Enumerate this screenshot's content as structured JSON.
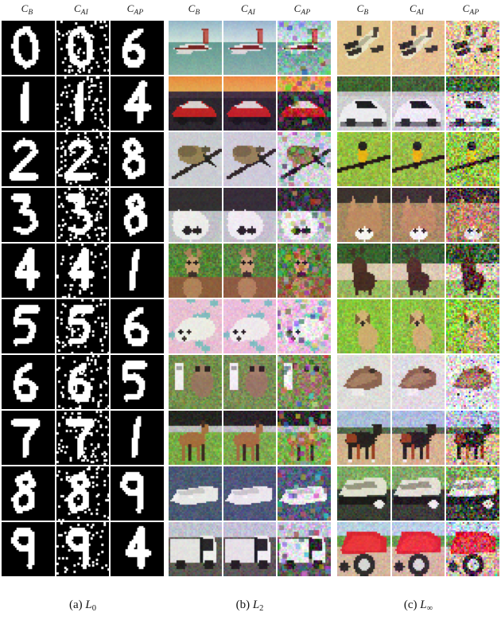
{
  "figure": {
    "type": "image-grid-figure",
    "rows": 10,
    "columns_per_panel": 3,
    "panels_count": 3,
    "column_header_labels": [
      "C_B",
      "C_AI",
      "C_AP"
    ],
    "header_base": "C",
    "header_subs": [
      "B",
      "AI",
      "AP"
    ]
  },
  "headers": [
    {
      "base": "C",
      "sub": "B"
    },
    {
      "base": "C",
      "sub": "AI"
    },
    {
      "base": "C",
      "sub": "AP"
    },
    {
      "base": "C",
      "sub": "B"
    },
    {
      "base": "C",
      "sub": "AI"
    },
    {
      "base": "C",
      "sub": "AP"
    },
    {
      "base": "C",
      "sub": "B"
    },
    {
      "base": "C",
      "sub": "AI"
    },
    {
      "base": "C",
      "sub": "AP"
    }
  ],
  "captions": [
    {
      "tag": "(a)",
      "var": "L",
      "sub": "0",
      "full": "(a) L0"
    },
    {
      "tag": "(b)",
      "var": "L",
      "sub": "2",
      "full": "(b) L2"
    },
    {
      "tag": "(c)",
      "var": "L",
      "sub": "∞",
      "full": "(c) L∞"
    }
  ],
  "panels": [
    {
      "id": "panel-a",
      "caption": "(a) L0",
      "dataset": "MNIST",
      "background": "#000000",
      "rows": [
        {
          "label": "0",
          "digit": 0,
          "adversarial_label": "6"
        },
        {
          "label": "1",
          "digit": 1,
          "adversarial_label": "4"
        },
        {
          "label": "2",
          "digit": 2,
          "adversarial_label": "8"
        },
        {
          "label": "3",
          "digit": 3,
          "adversarial_label": "8"
        },
        {
          "label": "4",
          "digit": 4,
          "adversarial_label": "1"
        },
        {
          "label": "5",
          "digit": 5,
          "adversarial_label": "6"
        },
        {
          "label": "6",
          "digit": 6,
          "adversarial_label": "5"
        },
        {
          "label": "7",
          "digit": 7,
          "adversarial_label": "1"
        },
        {
          "label": "8",
          "digit": 8,
          "adversarial_label": "9"
        },
        {
          "label": "9",
          "digit": 9,
          "adversarial_label": "4"
        }
      ]
    },
    {
      "id": "panel-b",
      "caption": "(b) L2",
      "dataset": "CIFAR-10",
      "rows": [
        {
          "class": "airplane"
        },
        {
          "class": "automobile"
        },
        {
          "class": "bird"
        },
        {
          "class": "cat"
        },
        {
          "class": "deer"
        },
        {
          "class": "dog"
        },
        {
          "class": "frog"
        },
        {
          "class": "horse"
        },
        {
          "class": "ship"
        },
        {
          "class": "truck"
        }
      ]
    },
    {
      "id": "panel-c",
      "caption": "(c) Linf",
      "dataset": "CIFAR-10",
      "rows": [
        {
          "class": "airplane"
        },
        {
          "class": "automobile"
        },
        {
          "class": "bird"
        },
        {
          "class": "cat"
        },
        {
          "class": "deer"
        },
        {
          "class": "dog"
        },
        {
          "class": "frog"
        },
        {
          "class": "horse"
        },
        {
          "class": "ship"
        },
        {
          "class": "truck"
        }
      ]
    }
  ],
  "colors": {
    "page_background": "#ffffff",
    "mnist_background": "#000000",
    "mnist_foreground": "#ffffff",
    "text": "#1a1a1a"
  }
}
